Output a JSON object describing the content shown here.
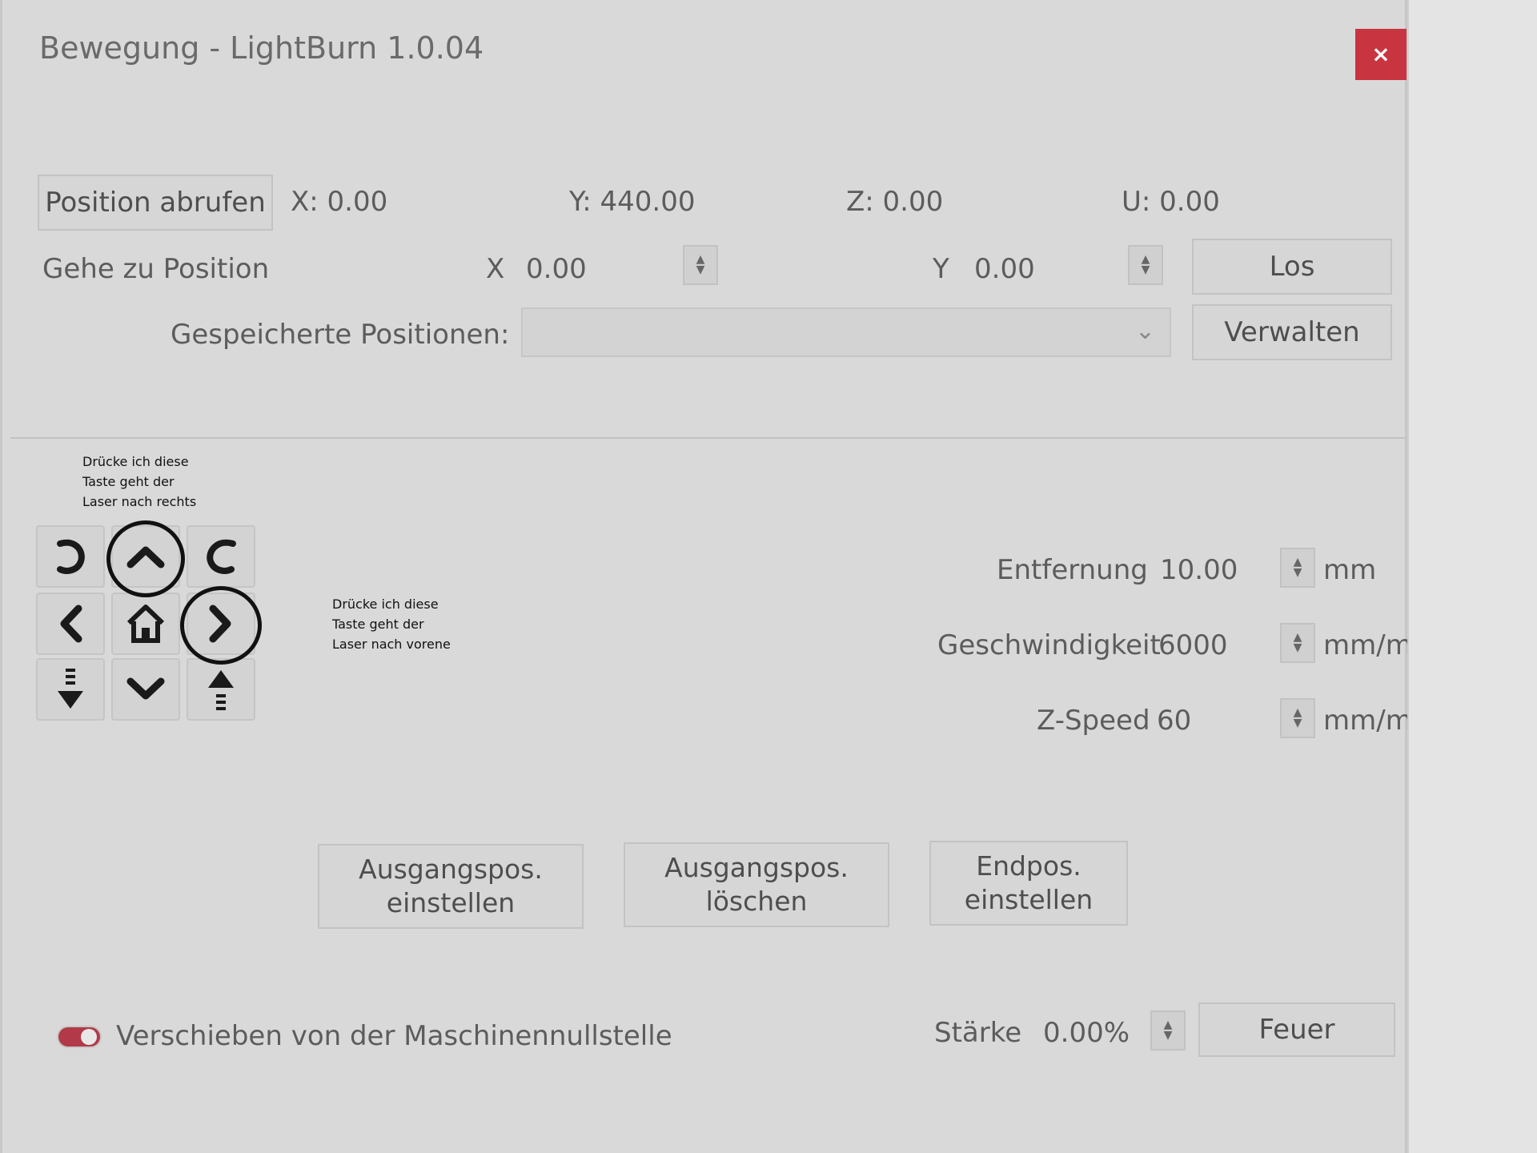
{
  "window": {
    "title": "Bewegung - LightBurn 1.0.04",
    "close_symbol": "×"
  },
  "position": {
    "get_button": "Position abrufen",
    "x": "X: 0.00",
    "y": "Y: 440.00",
    "z": "Z: 0.00",
    "u": "U: 0.00"
  },
  "goto": {
    "label": "Gehe zu Position",
    "x_label": "X",
    "x_value": "0.00",
    "y_label": "Y",
    "y_value": "0.00",
    "go_button": "Los"
  },
  "saved": {
    "label": "Gespeicherte Positionen:",
    "selected": "",
    "manage_button": "Verwalten"
  },
  "annotations": {
    "up": [
      "Drücke ich diese",
      "Taste geht der",
      "Laser nach rechts"
    ],
    "right": [
      "Drücke ich diese",
      "Taste geht der",
      "Laser nach vorene"
    ]
  },
  "jog": {
    "icons": [
      "rotate-ccw-icon",
      "arrow-up-icon",
      "rotate-cw-icon",
      "arrow-left-icon",
      "home-icon",
      "arrow-right-icon",
      "z-down-icon",
      "arrow-down-icon",
      "z-up-icon"
    ]
  },
  "settings": {
    "distance_label": "Entfernung",
    "distance_value": "10.00",
    "distance_unit": "mm",
    "speed_label": "Geschwindigkeit",
    "speed_value": "6000",
    "speed_unit": "mm/m",
    "zspeed_label": "Z-Speed",
    "zspeed_value": "60",
    "zspeed_unit": "mm/m"
  },
  "actions": {
    "set_origin": [
      "Ausgangspos.",
      "einstellen"
    ],
    "clear_origin": [
      "Ausgangspos.",
      "löschen"
    ],
    "set_finish": [
      "Endpos.",
      "einstellen"
    ]
  },
  "footer": {
    "toggle_label": "Verschieben von der Maschinennullstelle",
    "toggle_on": true,
    "power_label": "Stärke",
    "power_value": "0.00%",
    "fire_button": "Feuer"
  },
  "colors": {
    "close": "#c8343f",
    "toggle": "#b23a48"
  }
}
